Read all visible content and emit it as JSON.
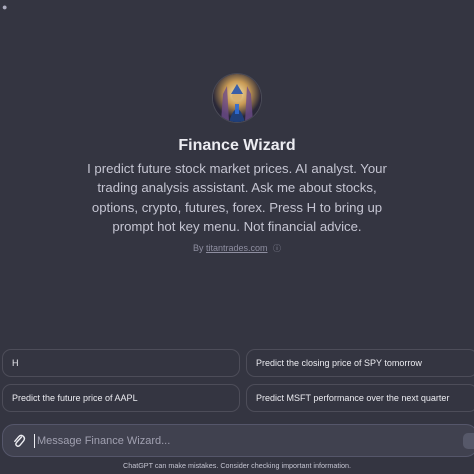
{
  "gpt": {
    "name": "Finance Wizard",
    "description": "I predict future stock market prices. AI analyst. Your trading analysis assistant. Ask me about stocks, options, crypto, futures, forex. Press H to bring up prompt hot key menu. Not financial advice.",
    "by_prefix": "By",
    "author": "titantrades.com"
  },
  "suggestions": [
    "H",
    "Predict the closing price of SPY tomorrow",
    "Predict the future price of AAPL",
    "Predict MSFT performance over the next quarter"
  ],
  "composer": {
    "placeholder": "Message Finance Wizard..."
  },
  "footer": {
    "disclaimer": "ChatGPT can make mistakes. Consider checking important information."
  },
  "colors": {
    "background": "#343541",
    "composer_bg": "#40414f",
    "border": "#4d4d59"
  }
}
